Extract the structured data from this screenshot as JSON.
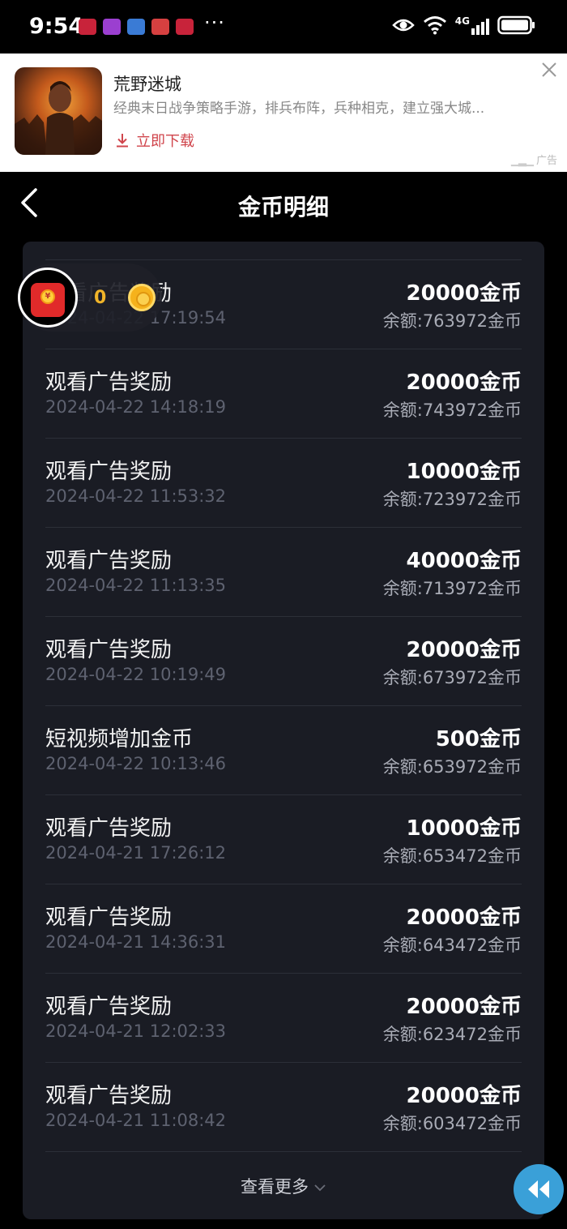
{
  "status_bar": {
    "time": "9:54",
    "dots": "···",
    "network": "4G"
  },
  "ad": {
    "title": "荒野迷城",
    "description": "经典末日战争策略手游，排兵布阵，兵种相克，建立强大城...",
    "download_label": "立即下载",
    "ad_tag": "广告",
    "accent_color": "#d0454c"
  },
  "header": {
    "title": "金币明细"
  },
  "floating_reward": {
    "count": "0"
  },
  "records": [
    {
      "title": "观看广告奖励",
      "time": "2024-04-22 17:19:54",
      "amount": "20000金币",
      "balance": "余额:763972金币"
    },
    {
      "title": "观看广告奖励",
      "time": "2024-04-22 14:18:19",
      "amount": "20000金币",
      "balance": "余额:743972金币"
    },
    {
      "title": "观看广告奖励",
      "time": "2024-04-22 11:53:32",
      "amount": "10000金币",
      "balance": "余额:723972金币"
    },
    {
      "title": "观看广告奖励",
      "time": "2024-04-22 11:13:35",
      "amount": "40000金币",
      "balance": "余额:713972金币"
    },
    {
      "title": "观看广告奖励",
      "time": "2024-04-22 10:19:49",
      "amount": "20000金币",
      "balance": "余额:673972金币"
    },
    {
      "title": "短视频增加金币",
      "time": "2024-04-22 10:13:46",
      "amount": "500金币",
      "balance": "余额:653972金币"
    },
    {
      "title": "观看广告奖励",
      "time": "2024-04-21 17:26:12",
      "amount": "10000金币",
      "balance": "余额:653472金币"
    },
    {
      "title": "观看广告奖励",
      "time": "2024-04-21 14:36:31",
      "amount": "20000金币",
      "balance": "余额:643472金币"
    },
    {
      "title": "观看广告奖励",
      "time": "2024-04-21 12:02:33",
      "amount": "20000金币",
      "balance": "余额:623472金币"
    },
    {
      "title": "观看广告奖励",
      "time": "2024-04-21 11:08:42",
      "amount": "20000金币",
      "balance": "余额:603472金币"
    }
  ],
  "more_label": "查看更多"
}
